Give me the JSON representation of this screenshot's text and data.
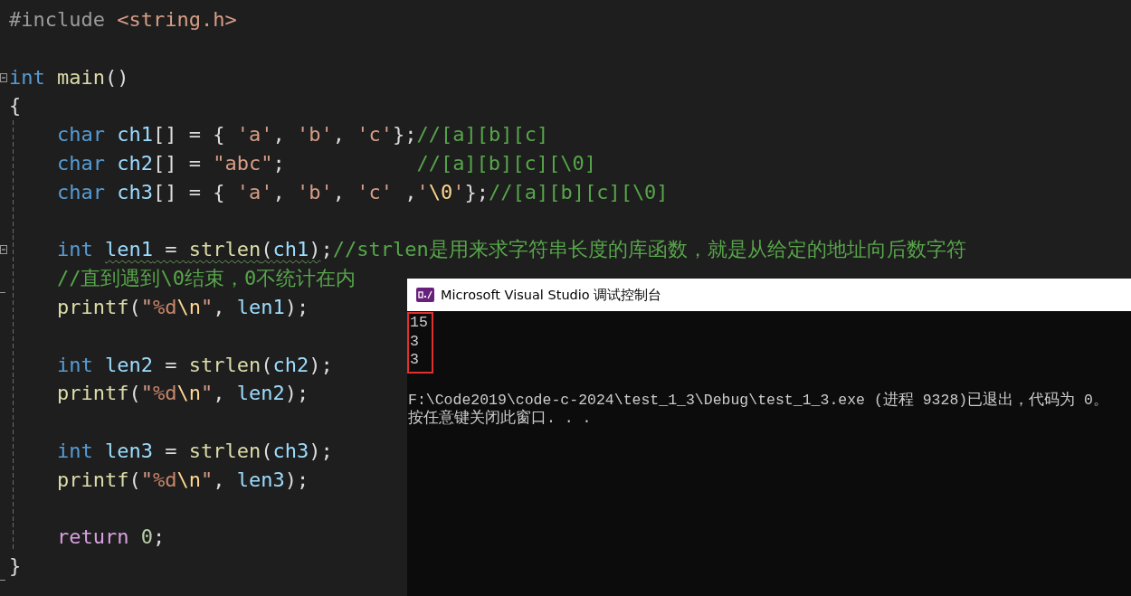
{
  "editor": {
    "lines": [
      {
        "kind": "code",
        "tokens": [
          {
            "t": "#include ",
            "kind": "pp"
          },
          {
            "t": "<string.h>",
            "kind": "s"
          }
        ]
      },
      {
        "kind": "blank"
      },
      {
        "kind": "code",
        "fold_start": true,
        "tokens": [
          {
            "t": "int ",
            "kind": "k"
          },
          {
            "t": "main",
            "kind": "f"
          },
          {
            "t": "()",
            "kind": "p"
          }
        ]
      },
      {
        "kind": "code",
        "tokens": [
          {
            "t": "{",
            "kind": "p"
          }
        ]
      },
      {
        "kind": "code",
        "guide": true,
        "tokens": [
          {
            "t": "    char ",
            "kind": "k"
          },
          {
            "t": "ch1",
            "kind": "v"
          },
          {
            "t": "[] = { ",
            "kind": "p"
          },
          {
            "t": "'a'",
            "kind": "s"
          },
          {
            "t": ", ",
            "kind": "p"
          },
          {
            "t": "'b'",
            "kind": "s"
          },
          {
            "t": ", ",
            "kind": "p"
          },
          {
            "t": "'c'",
            "kind": "s"
          },
          {
            "t": "};",
            "kind": "p"
          },
          {
            "t": "//[a][b][c]",
            "kind": "c"
          }
        ]
      },
      {
        "kind": "code",
        "guide": true,
        "tokens": [
          {
            "t": "    char ",
            "kind": "k"
          },
          {
            "t": "ch2",
            "kind": "v"
          },
          {
            "t": "[] = ",
            "kind": "p"
          },
          {
            "t": "\"abc\"",
            "kind": "s"
          },
          {
            "t": ";           ",
            "kind": "p"
          },
          {
            "t": "//[a][b][c][\\0]",
            "kind": "c"
          }
        ]
      },
      {
        "kind": "code",
        "guide": true,
        "tokens": [
          {
            "t": "    char ",
            "kind": "k"
          },
          {
            "t": "ch3",
            "kind": "v"
          },
          {
            "t": "[] = { ",
            "kind": "p"
          },
          {
            "t": "'a'",
            "kind": "s"
          },
          {
            "t": ", ",
            "kind": "p"
          },
          {
            "t": "'b'",
            "kind": "s"
          },
          {
            "t": ", ",
            "kind": "p"
          },
          {
            "t": "'c'",
            "kind": "s"
          },
          {
            "t": " ,",
            "kind": "p"
          },
          {
            "t": "'",
            "kind": "s"
          },
          {
            "t": "\\0",
            "kind": "e"
          },
          {
            "t": "'",
            "kind": "s"
          },
          {
            "t": "};",
            "kind": "p"
          },
          {
            "t": "//[a][b][c][\\0]",
            "kind": "c"
          }
        ]
      },
      {
        "kind": "blank",
        "guide": true
      },
      {
        "kind": "code",
        "guide": true,
        "fold_start": true,
        "tokens": [
          {
            "t": "    int ",
            "kind": "k"
          },
          {
            "t": "len1",
            "kind": "v",
            "squiggle": true
          },
          {
            "t": " = ",
            "kind": "p",
            "squiggle": true
          },
          {
            "t": "strlen",
            "kind": "f",
            "squiggle": true
          },
          {
            "t": "(",
            "kind": "p",
            "squiggle": true
          },
          {
            "t": "ch1",
            "kind": "v",
            "squiggle": true
          },
          {
            "t": ")",
            "kind": "p",
            "squiggle": true
          },
          {
            "t": ";",
            "kind": "p"
          },
          {
            "t": "//strlen是用来求字符串长度的库函数，就是从给定的地址向后数字符",
            "kind": "c"
          }
        ]
      },
      {
        "kind": "code",
        "guide": true,
        "fold_end": true,
        "tokens": [
          {
            "t": "    //直到遇到\\0结束，0不统计在内",
            "kind": "c"
          }
        ]
      },
      {
        "kind": "code",
        "guide": true,
        "tokens": [
          {
            "t": "    printf",
            "kind": "f"
          },
          {
            "t": "(",
            "kind": "p"
          },
          {
            "t": "\"",
            "kind": "s"
          },
          {
            "t": "%d",
            "kind": "fmt"
          },
          {
            "t": "\\n",
            "kind": "e"
          },
          {
            "t": "\"",
            "kind": "s"
          },
          {
            "t": ", ",
            "kind": "p"
          },
          {
            "t": "len1",
            "kind": "v"
          },
          {
            "t": ");",
            "kind": "p"
          }
        ]
      },
      {
        "kind": "blank",
        "guide": true
      },
      {
        "kind": "code",
        "guide": true,
        "tokens": [
          {
            "t": "    int ",
            "kind": "k"
          },
          {
            "t": "len2",
            "kind": "v"
          },
          {
            "t": " = ",
            "kind": "p"
          },
          {
            "t": "strlen",
            "kind": "f"
          },
          {
            "t": "(",
            "kind": "p"
          },
          {
            "t": "ch2",
            "kind": "v"
          },
          {
            "t": ");",
            "kind": "p"
          }
        ]
      },
      {
        "kind": "code",
        "guide": true,
        "tokens": [
          {
            "t": "    printf",
            "kind": "f"
          },
          {
            "t": "(",
            "kind": "p"
          },
          {
            "t": "\"",
            "kind": "s"
          },
          {
            "t": "%d",
            "kind": "fmt"
          },
          {
            "t": "\\n",
            "kind": "e"
          },
          {
            "t": "\"",
            "kind": "s"
          },
          {
            "t": ", ",
            "kind": "p"
          },
          {
            "t": "len2",
            "kind": "v"
          },
          {
            "t": ");",
            "kind": "p"
          }
        ]
      },
      {
        "kind": "blank",
        "guide": true
      },
      {
        "kind": "code",
        "guide": true,
        "tokens": [
          {
            "t": "    int ",
            "kind": "k"
          },
          {
            "t": "len3",
            "kind": "v"
          },
          {
            "t": " = ",
            "kind": "p"
          },
          {
            "t": "strlen",
            "kind": "f"
          },
          {
            "t": "(",
            "kind": "p"
          },
          {
            "t": "ch3",
            "kind": "v"
          },
          {
            "t": ");",
            "kind": "p"
          }
        ]
      },
      {
        "kind": "code",
        "guide": true,
        "tokens": [
          {
            "t": "    printf",
            "kind": "f"
          },
          {
            "t": "(",
            "kind": "p"
          },
          {
            "t": "\"",
            "kind": "s"
          },
          {
            "t": "%d",
            "kind": "fmt"
          },
          {
            "t": "\\n",
            "kind": "e"
          },
          {
            "t": "\"",
            "kind": "s"
          },
          {
            "t": ", ",
            "kind": "p"
          },
          {
            "t": "len3",
            "kind": "v"
          },
          {
            "t": ");",
            "kind": "p"
          }
        ]
      },
      {
        "kind": "blank",
        "guide": true
      },
      {
        "kind": "code",
        "guide": true,
        "tokens": [
          {
            "t": "    return ",
            "kind": "r"
          },
          {
            "t": "0",
            "kind": "n"
          },
          {
            "t": ";",
            "kind": "p"
          }
        ]
      },
      {
        "kind": "code",
        "fold_end": true,
        "tokens": [
          {
            "t": "}",
            "kind": "p"
          }
        ]
      }
    ]
  },
  "console": {
    "title": "Microsoft Visual Studio 调试控制台",
    "output": {
      "highlighted": true,
      "lines": [
        "15",
        "3",
        "3"
      ]
    },
    "messages": [
      "F:\\Code2019\\code-c-2024\\test_1_3\\Debug\\test_1_3.exe (进程 9328)已退出，代码为 0。",
      "按任意键关闭此窗口. . ."
    ]
  }
}
